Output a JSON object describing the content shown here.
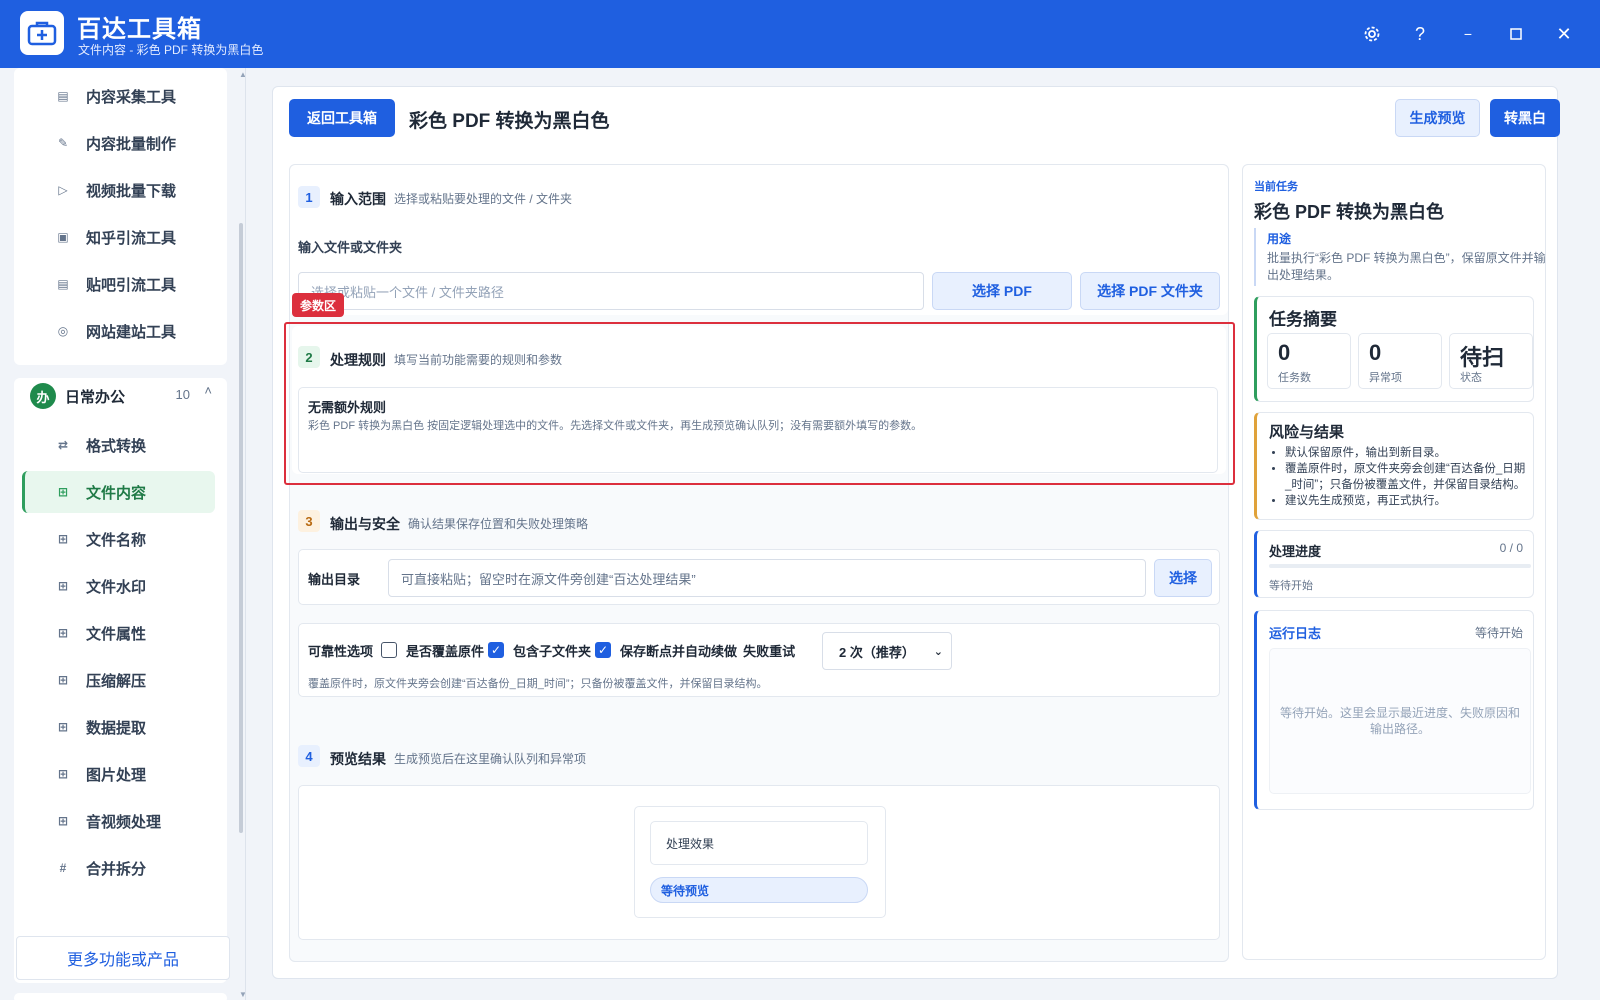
{
  "app": {
    "title": "百达工具箱",
    "subtitle": "文件内容 - 彩色 PDF 转换为黑白色"
  },
  "sidebar": {
    "top_items": [
      {
        "label": "内容采集工具",
        "icon": "document-icon"
      },
      {
        "label": "内容批量制作",
        "icon": "pen-icon"
      },
      {
        "label": "视频批量下载",
        "icon": "video-icon"
      },
      {
        "label": "知乎引流工具",
        "icon": "zhihu-icon"
      },
      {
        "label": "贴吧引流工具",
        "icon": "forum-icon"
      },
      {
        "label": "网站建站工具",
        "icon": "globe-icon"
      }
    ],
    "group": {
      "badge": "办",
      "name": "日常办公",
      "count": "10",
      "chevron": "˄"
    },
    "group_items": [
      {
        "label": "格式转换",
        "icon": "swap-icon"
      },
      {
        "label": "文件内容",
        "icon": "grid-icon",
        "active": true
      },
      {
        "label": "文件名称",
        "icon": "grid-icon"
      },
      {
        "label": "文件水印",
        "icon": "grid-icon"
      },
      {
        "label": "文件属性",
        "icon": "grid-icon"
      },
      {
        "label": "压缩解压",
        "icon": "grid-icon"
      },
      {
        "label": "数据提取",
        "icon": "grid-icon"
      },
      {
        "label": "图片处理",
        "icon": "grid-icon"
      },
      {
        "label": "音视频处理",
        "icon": "grid-icon"
      },
      {
        "label": "合并拆分",
        "icon": "hash-icon"
      }
    ],
    "more": "更多功能或产品"
  },
  "header": {
    "back": "返回工具箱",
    "title": "彩色 PDF 转换为黑白色",
    "preview": "生成预览",
    "convert": "转黑白"
  },
  "section1": {
    "num": "1",
    "title": "输入范围",
    "desc": "选择或粘贴要处理的文件 / 文件夹",
    "field_label": "输入文件或文件夹",
    "placeholder": "选择或粘贴一个文件 / 文件夹路径",
    "btn_pdf": "选择 PDF",
    "btn_folder": "选择 PDF 文件夹"
  },
  "param_tag": "参数区",
  "section2": {
    "num": "2",
    "title": "处理规则",
    "desc": "填写当前功能需要的规则和参数",
    "rule_title": "无需额外规则",
    "rule_desc": "彩色 PDF 转换为黑白色 按固定逻辑处理选中的文件。先选择文件或文件夹，再生成预览确认队列；没有需要额外填写的参数。"
  },
  "section3": {
    "num": "3",
    "title": "输出与安全",
    "desc": "确认结果保存位置和失败处理策略",
    "out_label": "输出目录",
    "out_placeholder": "可直接粘贴；留空时在源文件旁创建“百达处理结果”",
    "out_btn": "选择",
    "opt_label": "可靠性选项",
    "opt_overwrite": "是否覆盖原件",
    "opt_overwrite_checked": false,
    "opt_sub": "包含子文件夹",
    "opt_sub_checked": true,
    "opt_resume": "保存断点并自动续做",
    "opt_resume_checked": true,
    "retry_label": "失败重试",
    "retry_value": "2 次（推荐）",
    "note": "覆盖原件时，原文件夹旁会创建“百达备份_日期_时间”；只备份被覆盖文件，并保留目录结构。"
  },
  "section4": {
    "num": "4",
    "title": "预览结果",
    "desc": "生成预览后在这里确认队列和异常项",
    "effect_label": "处理效果",
    "status": "等待预览"
  },
  "right": {
    "task_caption": "当前任务",
    "task_title": "彩色 PDF 转换为黑白色",
    "purpose_label": "用途",
    "purpose_text": "批量执行“彩色 PDF 转换为黑白色”，保留原文件并输出处理结果。",
    "summary_title": "任务摘要",
    "stats": [
      {
        "value": "0",
        "label": "任务数"
      },
      {
        "value": "0",
        "label": "异常项"
      },
      {
        "value": "待扫",
        "label": "状态"
      }
    ],
    "risk_title": "风险与结果",
    "risks": [
      "默认保留原件，输出到新目录。",
      "覆盖原件时，原文件夹旁会创建“百达备份_日期_时间”；只备份被覆盖文件，并保留目录结构。",
      "建议先生成预览，再正式执行。"
    ],
    "progress_title": "处理进度",
    "progress_count": "0 / 0",
    "progress_value": 0,
    "progress_status": "等待开始",
    "log_title": "运行日志",
    "log_status": "等待开始",
    "log_placeholder": "等待开始。这里会显示最近进度、失败原因和输出路径。"
  },
  "colors": {
    "primary": "#1f5fe0",
    "accent_green": "#2f9e5e",
    "warning": "#e0a23a",
    "highlight_red": "#dc2f3d"
  }
}
